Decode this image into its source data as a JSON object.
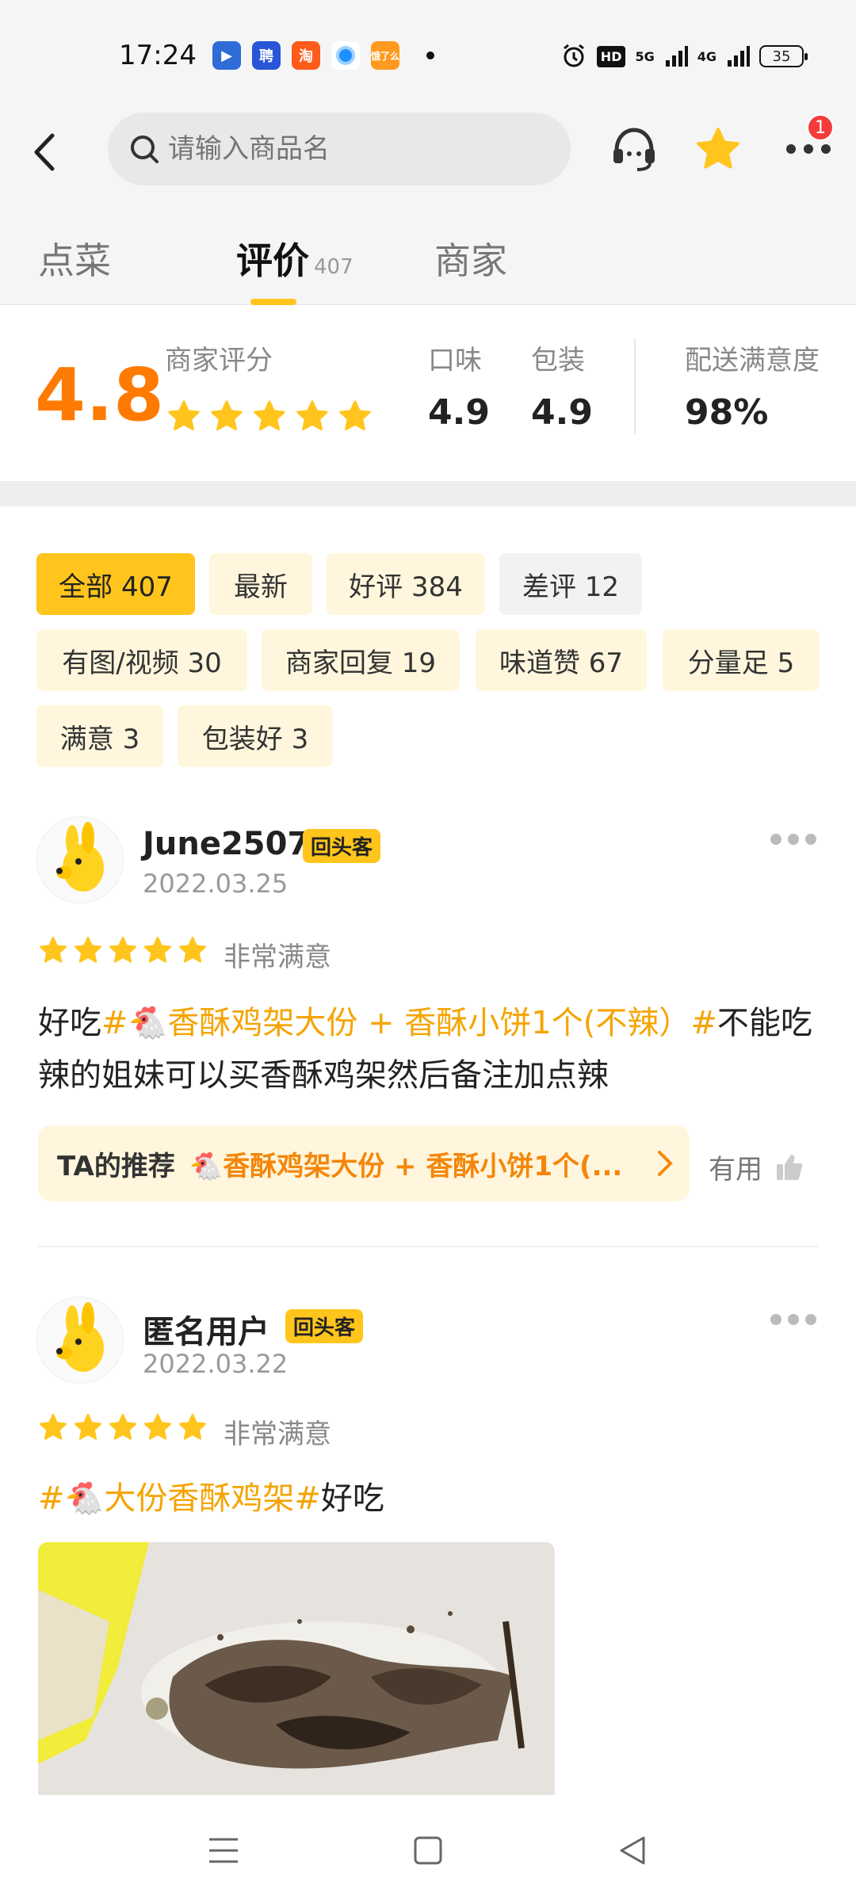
{
  "status_bar": {
    "time": "17:24",
    "apps": [
      "video-app",
      "recruit-app",
      "taobao-app",
      "browser-app",
      "ele-app"
    ],
    "app_labels": [
      "",
      "聘",
      "淘",
      "",
      "饿了么"
    ],
    "hd": "HD",
    "signal1": "5G",
    "signal2": "4G",
    "battery": "35"
  },
  "header": {
    "search_placeholder": "请输入商品名",
    "notification_count": "1"
  },
  "tabs": {
    "order": "点菜",
    "reviews": "评价",
    "reviews_count": "407",
    "merchant": "商家"
  },
  "summary": {
    "score": "4.8",
    "score_label": "商家评分",
    "stars": 5,
    "taste_label": "口味",
    "taste_value": "4.9",
    "package_label": "包装",
    "package_value": "4.9",
    "delivery_label": "配送满意度",
    "delivery_value": "98%"
  },
  "filters": [
    "全部 407",
    "最新",
    "好评 384",
    "差评 12",
    "有图/视频 30",
    "商家回复 19",
    "味道赞 67",
    "分量足 5",
    "满意 3",
    "包装好 3"
  ],
  "reviews": [
    {
      "user": "June2507",
      "tag": "回头客",
      "date": "2022.03.25",
      "level": "非常满意",
      "text_prefix": "好吃",
      "text_highlight": "#🐔香酥鸡架大份 + 香酥小饼1个(不辣）#",
      "text_suffix": "不能吃辣的姐妹可以买香酥鸡架然后备注加点辣",
      "rec_label": "TA的推荐",
      "rec_dish": "🐔香酥鸡架大份 + 香酥小饼1个(...",
      "useful": "有用"
    },
    {
      "user": "匿名用户",
      "tag": "回头客",
      "date": "2022.03.22",
      "level": "非常满意",
      "text_highlight": "#🐔大份香酥鸡架#",
      "text_suffix": "好吃"
    }
  ],
  "colors": {
    "accent": "#ffc51c",
    "score": "#ff7a00",
    "highlight": "#f5a400"
  }
}
